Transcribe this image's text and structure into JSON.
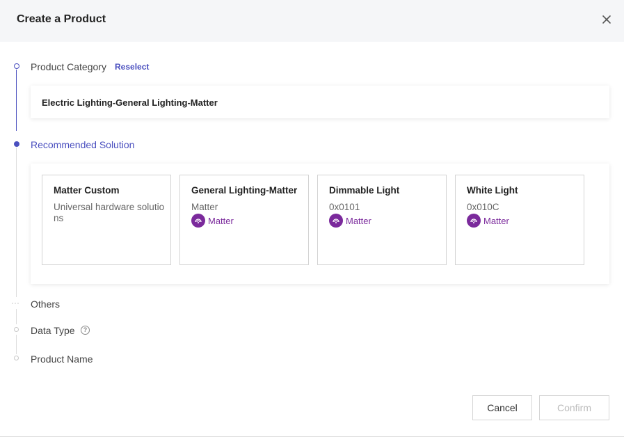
{
  "dialog": {
    "title": "Create a Product"
  },
  "steps": {
    "category": {
      "label": "Product Category",
      "action": "Reselect",
      "value": "Electric Lighting-General Lighting-Matter"
    },
    "solution": {
      "label": "Recommended Solution"
    },
    "others": {
      "label": "Others"
    },
    "data_type": {
      "label": "Data Type"
    },
    "product_name": {
      "label": "Product Name"
    }
  },
  "solutions": [
    {
      "title": "Matter Custom",
      "subtitle": "Universal hardware solutions",
      "tag": ""
    },
    {
      "title": "General Lighting-Matter",
      "subtitle": "Matter",
      "tag": "Matter"
    },
    {
      "title": "Dimmable Light",
      "subtitle": "0x0101",
      "tag": "Matter"
    },
    {
      "title": "White Light",
      "subtitle": "0x010C",
      "tag": "Matter"
    }
  ],
  "footer": {
    "cancel": "Cancel",
    "confirm": "Confirm"
  },
  "colors": {
    "accent": "#4a4fbf",
    "matter_tag": "#7b2a9c"
  },
  "icons": {
    "close": "close-icon",
    "help": "question-circle-icon",
    "matter": "matter-logo-icon"
  }
}
